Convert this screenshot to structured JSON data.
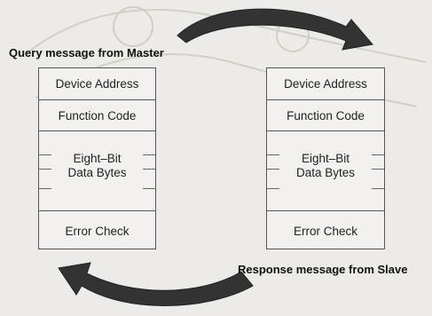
{
  "diagram": {
    "query_caption": "Query message from Master",
    "response_caption": "Response message from Slave",
    "frames": [
      {
        "fields": {
          "address": "Device Address",
          "function": "Function Code",
          "data_line1": "Eight–Bit",
          "data_line2": "Data Bytes",
          "error": "Error Check"
        }
      },
      {
        "fields": {
          "address": "Device Address",
          "function": "Function Code",
          "data_line1": "Eight–Bit",
          "data_line2": "Data Bytes",
          "error": "Error Check"
        }
      }
    ]
  }
}
